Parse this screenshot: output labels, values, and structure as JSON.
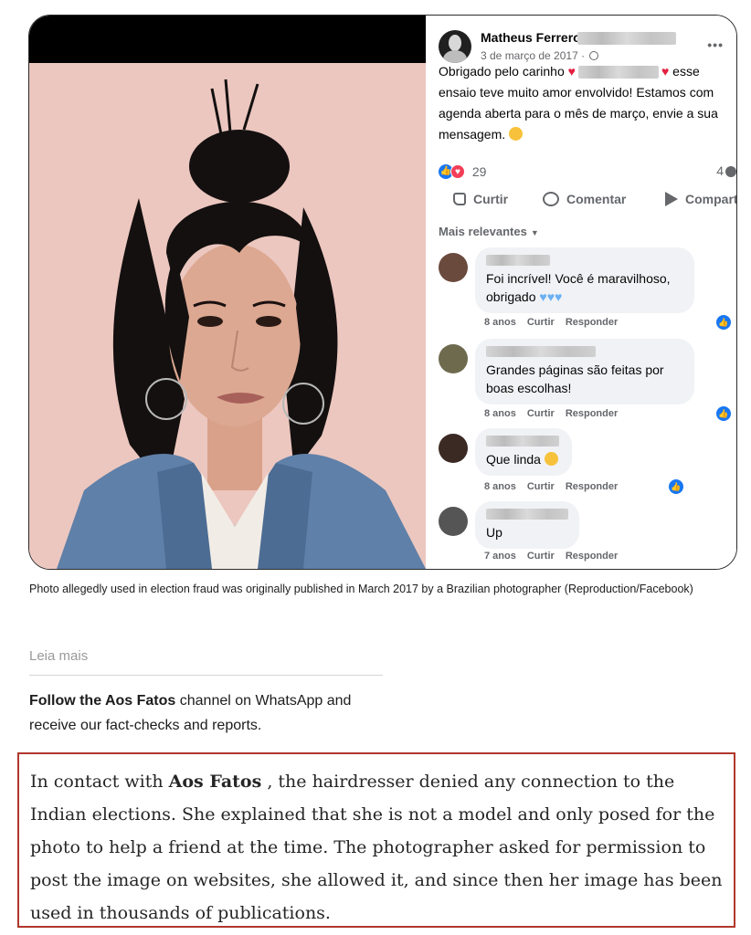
{
  "post": {
    "author": "Matheus Ferrero",
    "date": "3 de março de 2017 ·",
    "text_part1": "Obrigado pelo carinho",
    "text_part2": "esse ensaio teve muito amor envolvido! Estamos com agenda aberta para o mês de março, envie a sua mensagem.",
    "reaction_count": "29",
    "comment_count": "4",
    "actions": {
      "like": "Curtir",
      "comment": "Comentar",
      "share": "Compartilha"
    },
    "sort_label": "Mais relevantes",
    "icons": [
      "globe-icon",
      "more-icon",
      "heart-icon",
      "smile-icon",
      "thumb-icon",
      "bubble-icon",
      "share-icon",
      "chevron-down-icon"
    ]
  },
  "comments": [
    {
      "text": "Foi incrível! Você é maravilhoso, obrigado",
      "time": "8 anos",
      "like": "Curtir",
      "reply": "Responder"
    },
    {
      "text": "Grandes páginas são feitas por boas escolhas!",
      "time": "8 anos",
      "like": "Curtir",
      "reply": "Responder"
    },
    {
      "text": "Que linda",
      "time": "8 anos",
      "like": "Curtir",
      "reply": "Responder"
    },
    {
      "text": "Up",
      "time": "7 anos",
      "like": "Curtir",
      "reply": "Responder"
    }
  ],
  "caption": "Photo allegedly used in election fraud was originally published in March 2017 by a Brazilian photographer (Reproduction/Facebook)",
  "read_more": "Leia mais",
  "whatsapp": {
    "bold": "Follow the Aos Fatos",
    "rest": "channel on WhatsApp and receive our fact-checks and reports."
  },
  "quote": {
    "lead": "In contact with",
    "bold": "Aos Fatos",
    "rest": ", the hairdresser denied any connection to the Indian elections. She explained that she is not a model and only posed for the photo to help a friend at the time. The photographer asked for permission to post the image on websites, she allowed it, and since then her image has been used in thousands of publications."
  },
  "colors": {
    "fb_blue": "#1877f2",
    "heart_red": "#e41e3f",
    "quote_border": "#b0372c"
  }
}
